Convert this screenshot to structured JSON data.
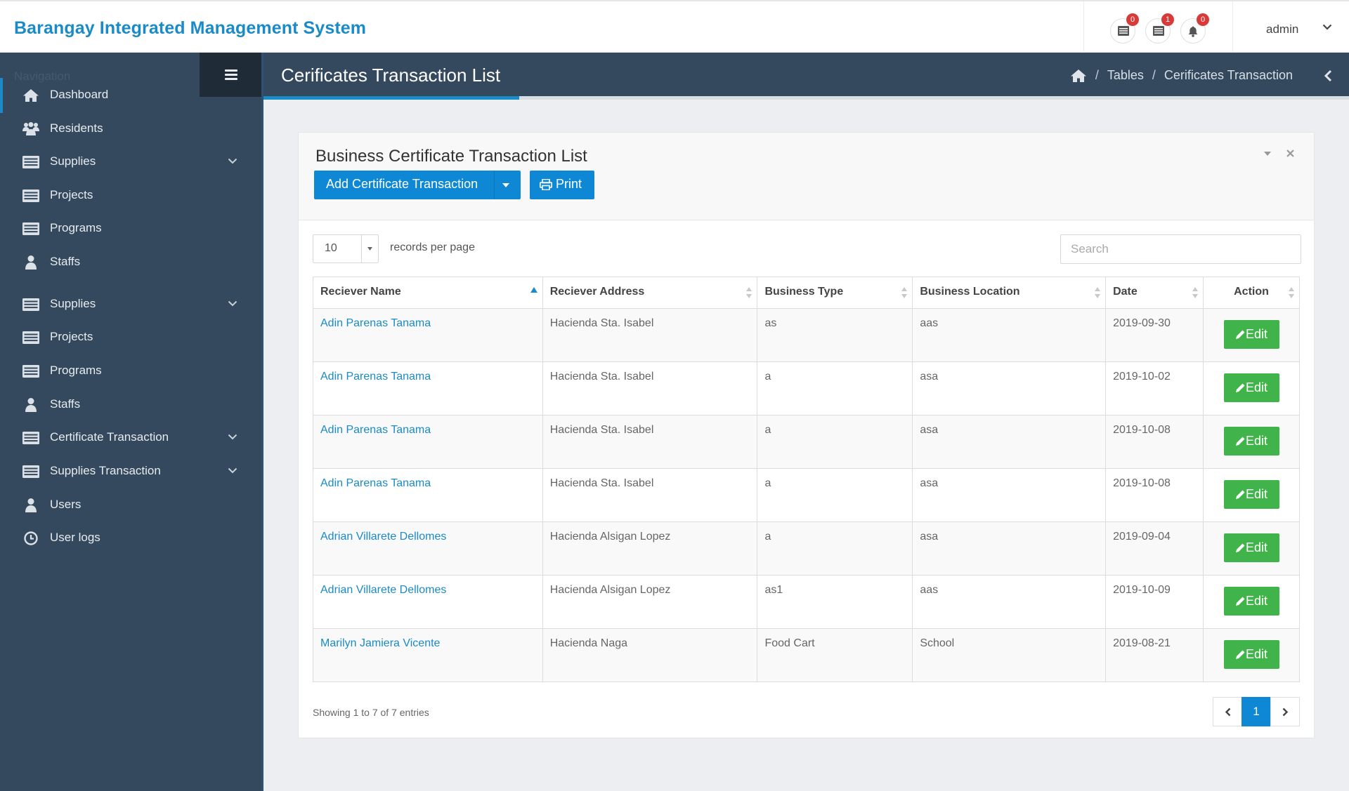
{
  "app": {
    "brand": "Barangay Integrated Management System",
    "user_name": "admin",
    "notifications": [
      {
        "icon": "list-icon",
        "count": "0"
      },
      {
        "icon": "list-icon",
        "count": "1"
      },
      {
        "icon": "bell-icon",
        "count": "0"
      }
    ]
  },
  "sidebar": {
    "title": "Navigation",
    "items": [
      {
        "label": "Dashboard",
        "icon": "home-icon",
        "active": true,
        "has_children": false
      },
      {
        "label": "Residents",
        "icon": "users-icon",
        "active": false,
        "has_children": false
      },
      {
        "label": "Supplies",
        "icon": "list-icon",
        "active": false,
        "has_children": true
      },
      {
        "label": "Projects",
        "icon": "list-icon",
        "active": false,
        "has_children": false
      },
      {
        "label": "Programs",
        "icon": "list-icon",
        "active": false,
        "has_children": false
      },
      {
        "label": "Staffs",
        "icon": "user-icon",
        "active": false,
        "has_children": false
      },
      {
        "label": "Supplies",
        "icon": "list-icon",
        "active": false,
        "has_children": true
      },
      {
        "label": "Projects",
        "icon": "list-icon",
        "active": false,
        "has_children": false
      },
      {
        "label": "Programs",
        "icon": "list-icon",
        "active": false,
        "has_children": false
      },
      {
        "label": "Staffs",
        "icon": "user-icon",
        "active": false,
        "has_children": false
      },
      {
        "label": "Certificate Transaction",
        "icon": "list-icon",
        "active": false,
        "has_children": true
      },
      {
        "label": "Supplies Transaction",
        "icon": "list-icon",
        "active": false,
        "has_children": true
      },
      {
        "label": "Users",
        "icon": "user-icon",
        "active": false,
        "has_children": false
      },
      {
        "label": "User logs",
        "icon": "clock-icon",
        "active": false,
        "has_children": false
      }
    ]
  },
  "header": {
    "title": "Cerificates Transaction List",
    "breadcrumb": [
      "Tables",
      "Cerificates Transaction"
    ]
  },
  "panel": {
    "title": "Business Certificate Transaction List",
    "add_button": "Add Certificate Transaction",
    "print_button": "Print",
    "page_length": "10",
    "records_label": "records per page",
    "search_placeholder": "Search"
  },
  "table": {
    "columns": [
      "Reciever Name",
      "Reciever Address",
      "Business Type",
      "Business Location",
      "Date",
      "Action"
    ],
    "edit_label": "Edit",
    "rows": [
      [
        "Adin Parenas Tanama",
        "Hacienda Sta. Isabel",
        "as",
        "aas",
        "2019-09-30"
      ],
      [
        "Adin Parenas Tanama",
        "Hacienda Sta. Isabel",
        "a",
        "asa",
        "2019-10-02"
      ],
      [
        "Adin Parenas Tanama",
        "Hacienda Sta. Isabel",
        "a",
        "asa",
        "2019-10-08"
      ],
      [
        "Adin Parenas Tanama",
        "Hacienda Sta. Isabel",
        "a",
        "asa",
        "2019-10-08"
      ],
      [
        "Adrian Villarete Dellomes",
        "Hacienda Alsigan Lopez",
        "a",
        "asa",
        "2019-09-04"
      ],
      [
        "Adrian Villarete Dellomes",
        "Hacienda Alsigan Lopez",
        "as1",
        "aas",
        "2019-10-09"
      ],
      [
        "Marilyn Jamiera Vicente",
        "Hacienda Naga",
        "Food Cart",
        "School",
        "2019-08-21"
      ]
    ]
  },
  "footer": {
    "info": "Showing 1 to 7 of 7 entries",
    "current_page": "1"
  },
  "colors": {
    "brand": "#1a8bc6",
    "sidebar_bg": "#34495e",
    "primary_button": "#0e88d4",
    "edit_button": "#41b34b",
    "badge": "#d83a3a"
  }
}
